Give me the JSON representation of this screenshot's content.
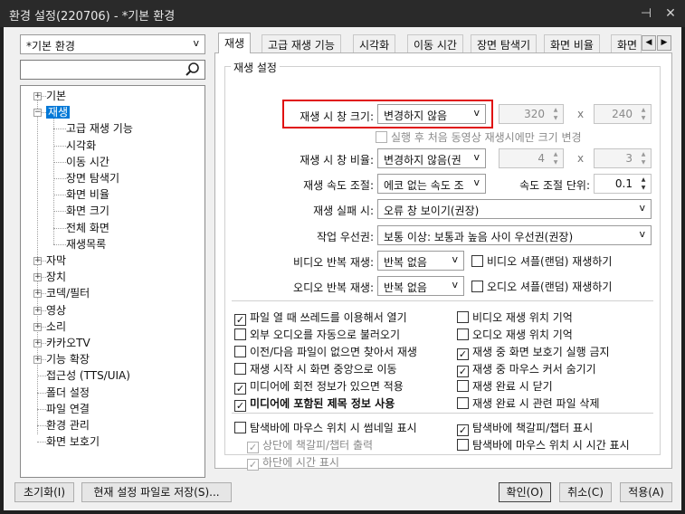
{
  "window": {
    "title": "환경 설정(220706) - *기본 환경",
    "pin": "⊣",
    "close": "✕"
  },
  "profile_combo": {
    "value": "*기본 환경",
    "arrow": "v"
  },
  "search": {
    "placeholder": ""
  },
  "tree": [
    {
      "label": "기본",
      "expander": "+"
    },
    {
      "label": "재생",
      "expander": "−",
      "selected": true
    },
    {
      "label": "고급 재생 기능"
    },
    {
      "label": "시각화"
    },
    {
      "label": "이동 시간"
    },
    {
      "label": "장면 탐색기"
    },
    {
      "label": "화면 비율"
    },
    {
      "label": "화면 크기"
    },
    {
      "label": "전체 화면"
    },
    {
      "label": "재생목록"
    },
    {
      "label": "자막",
      "expander": "+"
    },
    {
      "label": "장치",
      "expander": "+"
    },
    {
      "label": "코덱/필터",
      "expander": "+"
    },
    {
      "label": "영상",
      "expander": "+"
    },
    {
      "label": "소리",
      "expander": "+"
    },
    {
      "label": "카카오TV",
      "expander": "+"
    },
    {
      "label": "기능 확장",
      "expander": "+"
    },
    {
      "label": "접근성 (TTS/UIA)"
    },
    {
      "label": "폴더 설정"
    },
    {
      "label": "파일 연결"
    },
    {
      "label": "환경 관리"
    },
    {
      "label": "화면 보호기"
    }
  ],
  "tabs": [
    "재생",
    "고급 재생 기능",
    "시각화",
    "이동 시간",
    "장면 탐색기",
    "화면 비율",
    "화면"
  ],
  "tab_scroll": {
    "left": "◀",
    "right": "▶"
  },
  "group_title": "재생 설정",
  "settings": {
    "window_size_label": "재생 시 창 크기:",
    "window_size_value": "변경하지 않음",
    "width": "320",
    "height": "240",
    "times": "x",
    "first_only_label": "실행 후 처음 동영상 재생시에만 크기 변경",
    "ratio_label": "재생 시 창 비율:",
    "ratio_value": "변경하지 않음(권",
    "ratio_w": "4",
    "ratio_h": "3",
    "speed_label": "재생 속도 조절:",
    "speed_value": "에코 없는 속도 조",
    "speed_unit_label": "속도 조절 단위:",
    "speed_unit_value": "0.1",
    "fail_label": "재생 실패 시:",
    "fail_value": "오류 창 보이기(권장)",
    "priority_label": "작업 우선권:",
    "priority_value": "보통 이상: 보통과 높음 사이 우선권(권장)",
    "video_repeat_label": "비디오 반복 재생:",
    "video_repeat_value": "반복 없음",
    "video_shuffle_label": "비디오 셔플(랜덤) 재생하기",
    "audio_repeat_label": "오디오 반복 재생:",
    "audio_repeat_value": "반복 없음",
    "audio_shuffle_label": "오디오 셔플(랜덤) 재생하기",
    "arrow": "v"
  },
  "options_left": [
    {
      "label": "파일 열 때 쓰레드를 이용해서 열기",
      "checked": true
    },
    {
      "label": "외부 오디오를 자동으로 불러오기",
      "checked": false
    },
    {
      "label": "이전/다음 파일이 없으면 찾아서 재생",
      "checked": false
    },
    {
      "label": "재생 시작 시 화면 중앙으로 이동",
      "checked": false
    },
    {
      "label": "미디어에 회전 정보가 있으면 적용",
      "checked": true
    },
    {
      "label": "미디어에 포함된 제목 정보 사용",
      "checked": true,
      "bold": true
    }
  ],
  "options_right": [
    {
      "label": "비디오 재생 위치 기억",
      "checked": false
    },
    {
      "label": "오디오 재생 위치 기억",
      "checked": false
    },
    {
      "label": "재생 중 화면 보호기 실행 금지",
      "checked": true
    },
    {
      "label": "재생 중 마우스 커서 숨기기",
      "checked": true
    },
    {
      "label": "재생 완료 시 닫기",
      "checked": false
    },
    {
      "label": "재생 완료 시 관련 파일 삭제",
      "checked": false
    }
  ],
  "seek_left": [
    {
      "label": "탐색바에 마우스 위치 시 썸네일 표시",
      "checked": false
    },
    {
      "label": "상단에 책갈피/챕터 출력",
      "checked": true,
      "disabled": true
    },
    {
      "label": "하단에 시간 표시",
      "checked": true,
      "disabled": true
    }
  ],
  "seek_right": [
    {
      "label": "탐색바에 책갈피/챕터 표시",
      "checked": true
    },
    {
      "label": "탐색바에 마우스 위치 시 시간 표시",
      "checked": false
    }
  ],
  "buttons": {
    "reset": "초기화(I)",
    "save_file": "현재 설정 파일로 저장(S)...",
    "ok": "확인(O)",
    "cancel": "취소(C)",
    "apply": "적용(A)"
  },
  "check_mark": "✓",
  "highlight_color": "#e01010"
}
